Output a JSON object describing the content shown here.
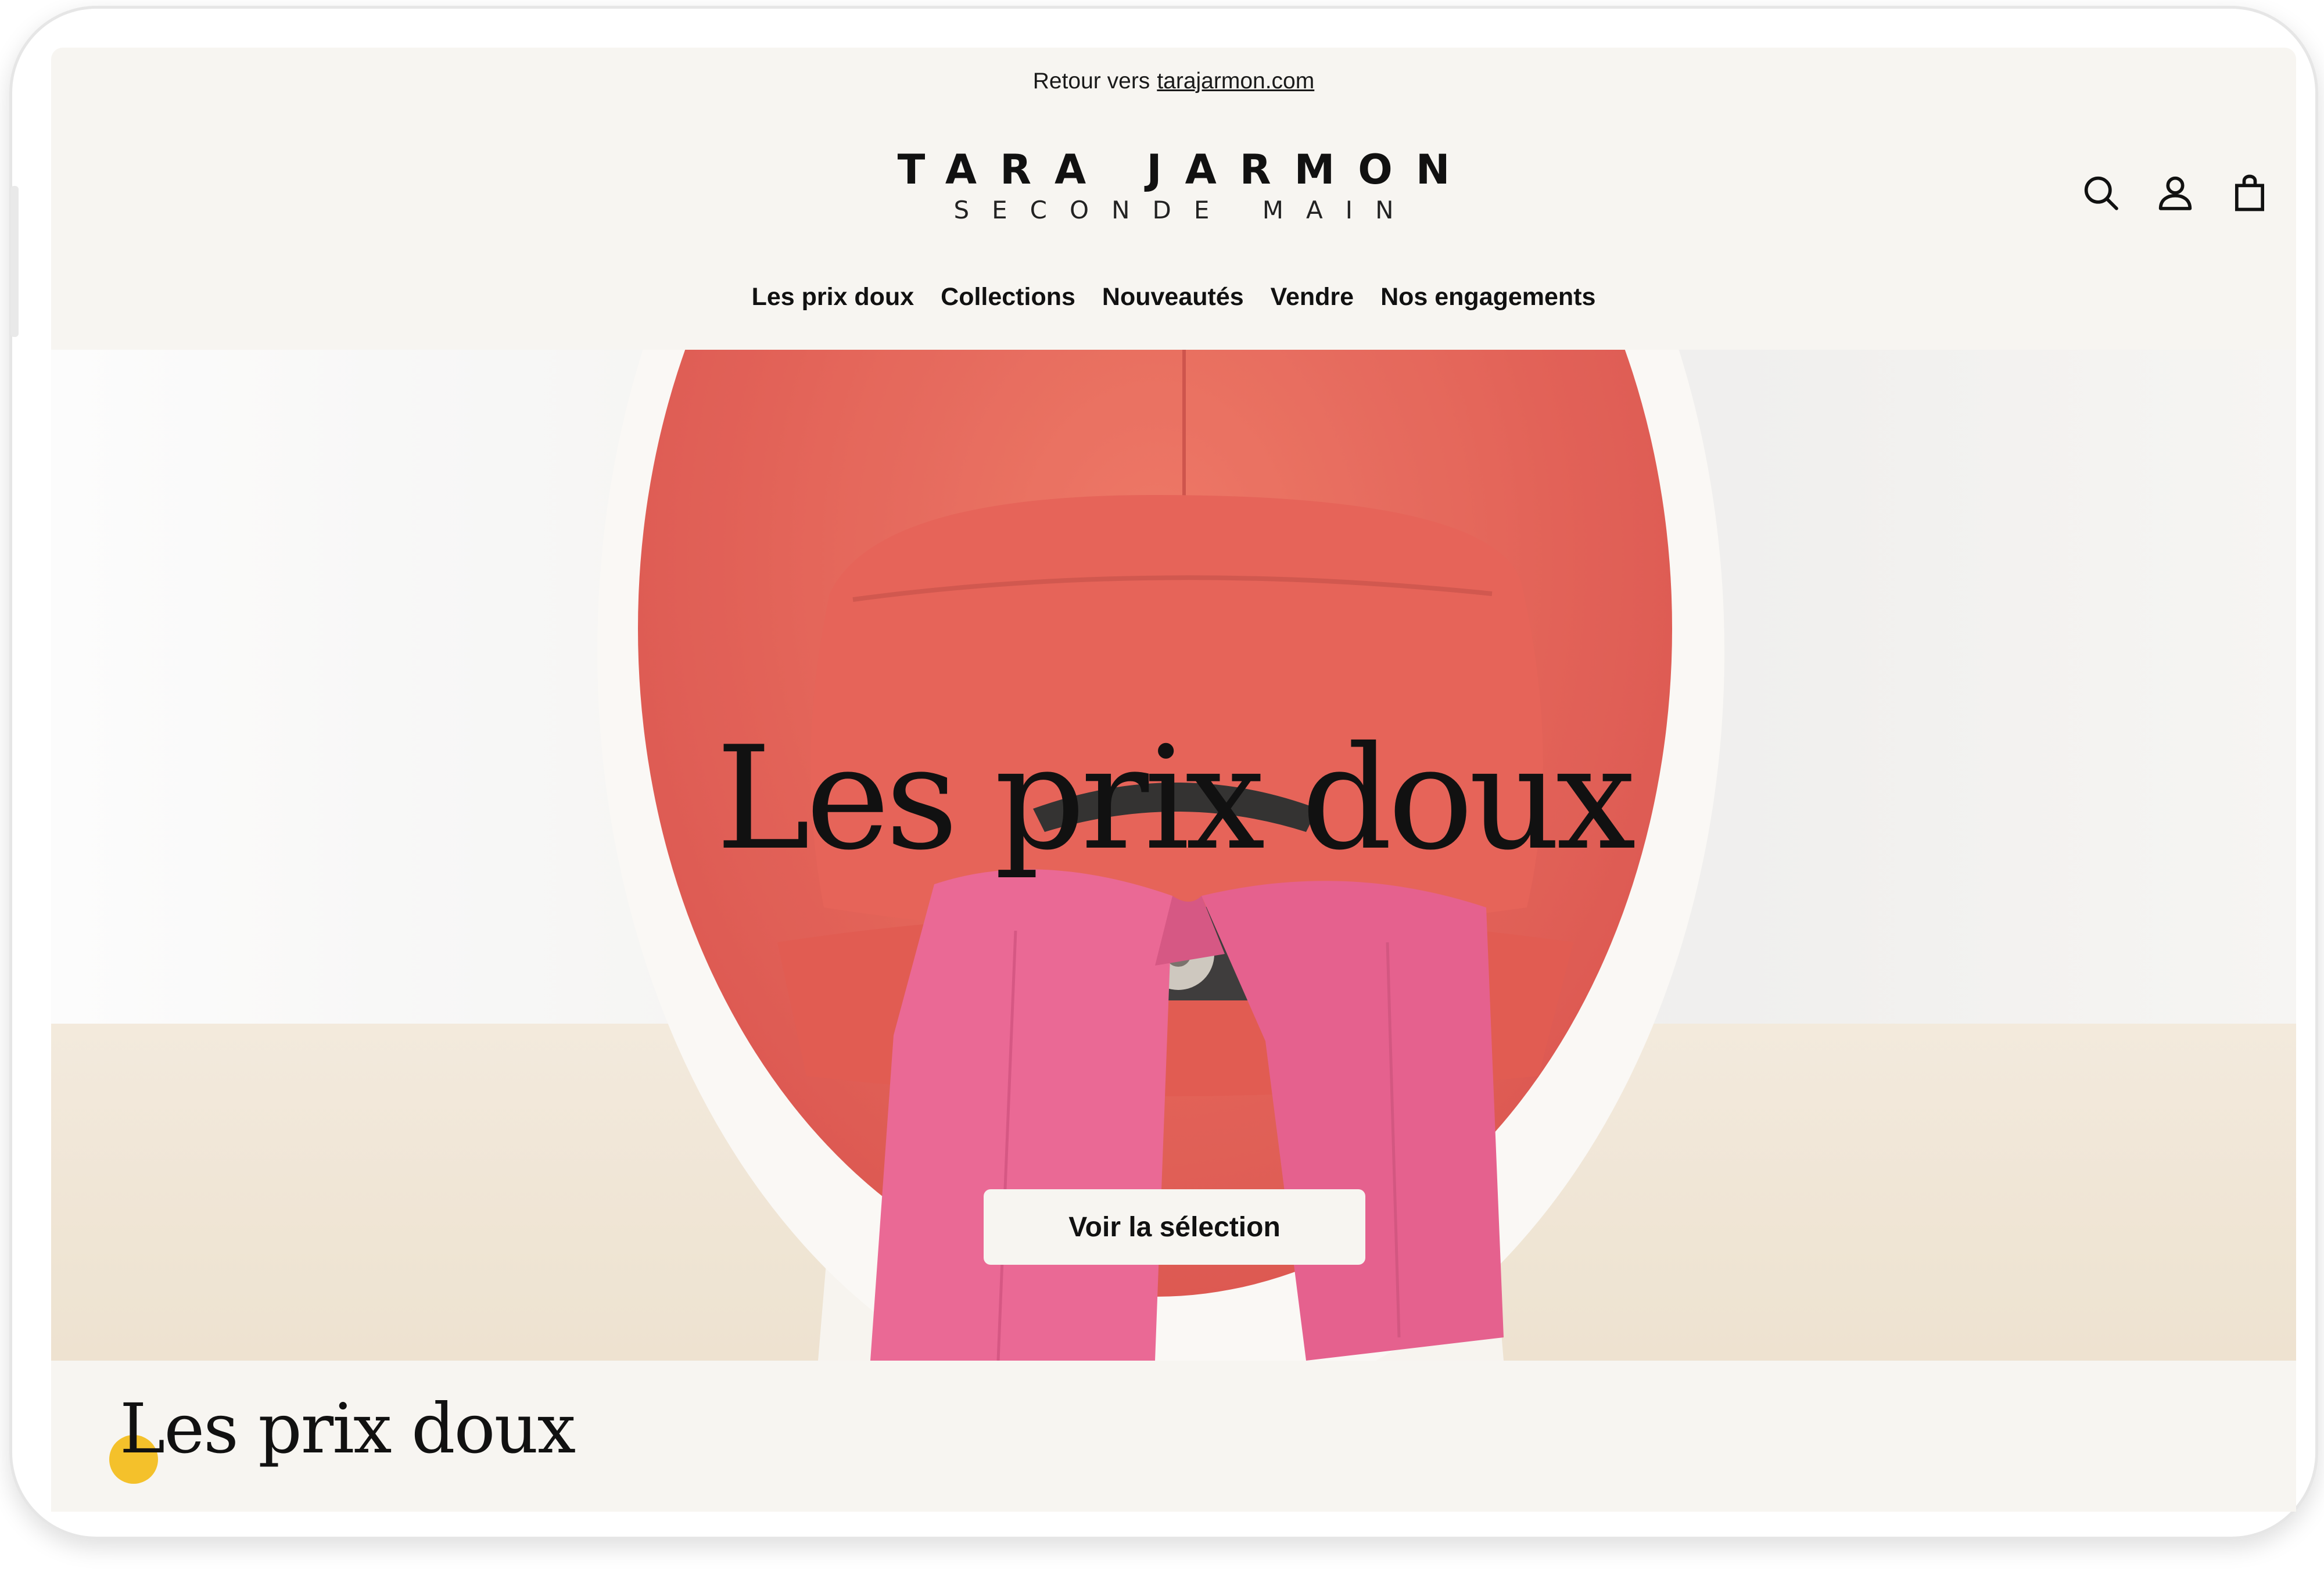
{
  "announcement": {
    "prefix": "Retour vers",
    "link": "tarajarmon.com"
  },
  "brand": {
    "name": "TARA JARMON",
    "subtitle": "SECONDE MAIN"
  },
  "header_icons": [
    "search-icon",
    "account-icon",
    "bag-icon"
  ],
  "nav": {
    "items": [
      {
        "label": "Les prix doux"
      },
      {
        "label": "Collections"
      },
      {
        "label": "Nouveautés"
      },
      {
        "label": "Vendre"
      },
      {
        "label": "Nos engagements"
      }
    ]
  },
  "hero": {
    "title": "Les prix doux",
    "cta": "Voir la sélection"
  },
  "section": {
    "title": "Les prix doux"
  },
  "colors": {
    "background": "#f7f5f1",
    "accent": "#f4c12b",
    "text": "#111111",
    "chair_red": "#e65a4c",
    "pants_pink": "#e85a86"
  }
}
